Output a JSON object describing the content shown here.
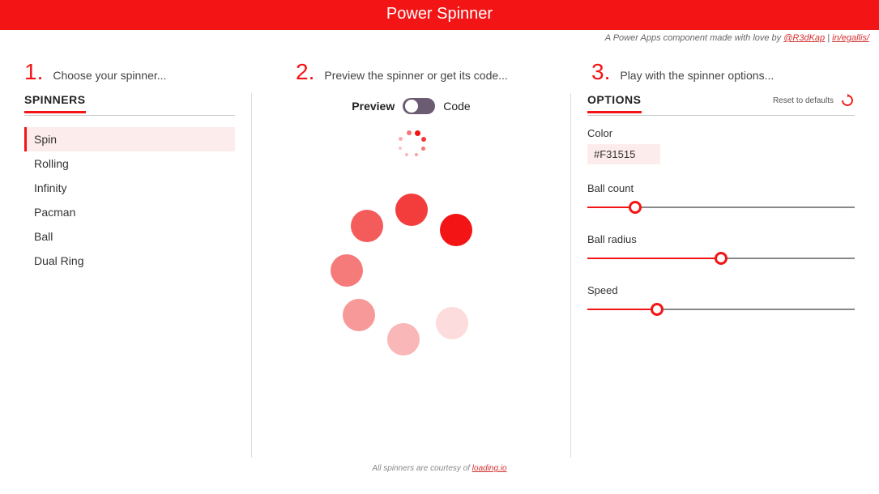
{
  "header": {
    "title": "Power Spinner"
  },
  "credits": {
    "prefix": "A Power Apps component made with love by ",
    "link1": "@R3dKap",
    "sep": " | ",
    "link2": "in/egallis/"
  },
  "steps": {
    "s1": {
      "num": "1.",
      "text": "Choose your spinner..."
    },
    "s2": {
      "num": "2.",
      "text": "Preview the spinner or get its code..."
    },
    "s3": {
      "num": "3.",
      "text": "Play with the spinner options..."
    }
  },
  "spinnersPanel": {
    "title": "SPINNERS",
    "items": [
      {
        "label": "Spin",
        "active": true
      },
      {
        "label": "Rolling",
        "active": false
      },
      {
        "label": "Infinity",
        "active": false
      },
      {
        "label": "Pacman",
        "active": false
      },
      {
        "label": "Ball",
        "active": false
      },
      {
        "label": "Dual Ring",
        "active": false
      }
    ]
  },
  "previewPanel": {
    "previewLabel": "Preview",
    "codeLabel": "Code"
  },
  "optionsPanel": {
    "title": "OPTIONS",
    "resetLabel": "Reset to defaults",
    "color": {
      "label": "Color",
      "value": "#F31515"
    },
    "ballCount": {
      "label": "Ball count",
      "percent": 18
    },
    "ballRadius": {
      "label": "Ball radius",
      "percent": 50
    },
    "speed": {
      "label": "Speed",
      "percent": 26
    }
  },
  "footer": {
    "prefix": "All spinners are courtesy of ",
    "link": "loading.io"
  }
}
